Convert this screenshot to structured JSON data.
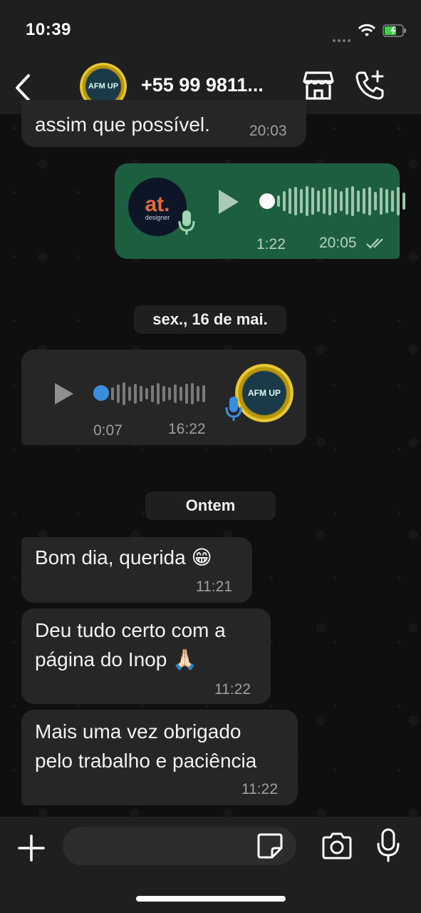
{
  "status": {
    "time": "10:39"
  },
  "header": {
    "contact": "+55 99 9811...",
    "avatar_text": "AFM UP"
  },
  "messages": {
    "m0": {
      "text": "assim que possível.",
      "time": "20:03"
    },
    "voice_out": {
      "avatar_text": "at.",
      "avatar_sub": "designer",
      "duration": "1:22",
      "time": "20:05",
      "status": "read"
    },
    "date1": "sex., 16 de mai.",
    "voice_in": {
      "avatar_text": "AFM UP",
      "duration": "0:07",
      "time": "16:22"
    },
    "date2": "Ontem",
    "m1": {
      "text": "Bom dia, querida 😁",
      "time": "11:21"
    },
    "m2": {
      "line1": "Deu tudo certo com a",
      "line2": "página do Inop 🙏🏻",
      "time": "11:22"
    },
    "m3": {
      "line1": "Mais uma vez obrigado",
      "line2": "pelo trabalho e paciência",
      "time": "11:22"
    }
  },
  "input": {
    "placeholder": ""
  },
  "colors": {
    "incoming": "#262626",
    "outgoing": "#1c5e3f",
    "accent_blue": "#3b8de0",
    "background": "#0f0f0f"
  }
}
